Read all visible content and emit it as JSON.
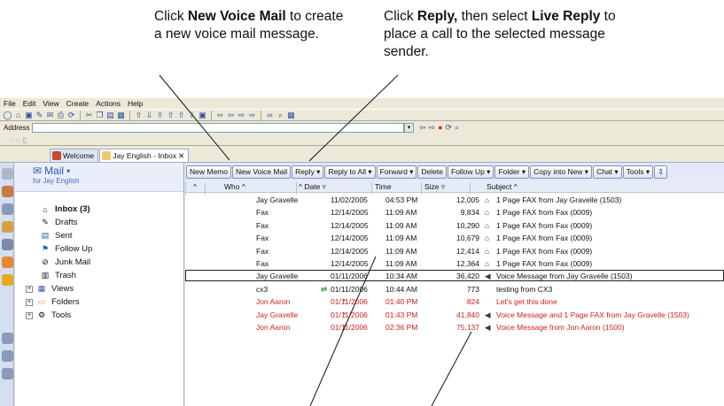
{
  "callouts": {
    "new_voice_mail": {
      "prefix": "Click ",
      "bold1": "New Voice Mail",
      "rest": " to create a new voice mail message."
    },
    "reply": {
      "prefix": "Click ",
      "bold1": "Reply,",
      "middle": " then select ",
      "bold2": "Live Reply",
      "rest": " to place a call to the selected message sender."
    }
  },
  "menu": [
    "File",
    "Edit",
    "View",
    "Create",
    "Actions",
    "Help"
  ],
  "address_label": "Address",
  "tabs": [
    {
      "label": "Welcome",
      "icon": "home-icon"
    },
    {
      "label": "Jay English - Inbox",
      "icon": "mail-icon"
    }
  ],
  "nav": {
    "title": "Mail",
    "subtitle": "for Jay English",
    "folders": [
      {
        "label": "Inbox (3)",
        "icon": "inbox-icon",
        "bold": true
      },
      {
        "label": "Drafts",
        "icon": "drafts-icon"
      },
      {
        "label": "Sent",
        "icon": "sent-icon"
      },
      {
        "label": "Follow Up",
        "icon": "follow-up-icon"
      },
      {
        "label": "Junk Mail",
        "icon": "junk-mail-icon"
      },
      {
        "label": "Trash",
        "icon": "trash-icon"
      },
      {
        "label": "Views",
        "icon": "views-icon"
      },
      {
        "label": "Folders",
        "icon": "folders-icon"
      },
      {
        "label": "Tools",
        "icon": "tools-icon"
      }
    ]
  },
  "action_buttons": [
    "New Memo",
    "New Voice Mail",
    "Reply ▾",
    "Reply to All ▾",
    "Forward ▾",
    "Delete",
    "Follow Up ▾",
    "Folder ▾",
    "Copy into New ▾",
    "Chat ▾",
    "Tools ▾"
  ],
  "columns": {
    "who": "Who ^",
    "date": "^ Date ▿",
    "time": "Time",
    "size": "Size ▿",
    "subject": "Subject ^"
  },
  "messages": [
    {
      "who": "Jay Gravelle",
      "date": "11/02/2005",
      "time": "04:53 PM",
      "size": "12,005",
      "subject": "1 Page FAX from Jay Gravelle (1503)",
      "urgent": false,
      "icon": "fax-icon"
    },
    {
      "who": "Fax",
      "date": "12/14/2005",
      "time": "11:09 AM",
      "size": "9,834",
      "subject": "1 Page FAX from Fax (0009)",
      "urgent": false,
      "icon": "fax-icon"
    },
    {
      "who": "Fax",
      "date": "12/14/2005",
      "time": "11:09 AM",
      "size": "10,290",
      "subject": "1 Page FAX from Fax (0009)",
      "urgent": false,
      "icon": "fax-icon"
    },
    {
      "who": "Fax",
      "date": "12/14/2005",
      "time": "11:09 AM",
      "size": "10,679",
      "subject": "1 Page FAX from Fax (0009)",
      "urgent": false,
      "icon": "fax-icon"
    },
    {
      "who": "Fax",
      "date": "12/14/2005",
      "time": "11:09 AM",
      "size": "12,414",
      "subject": "1 Page FAX from Fax (0009)",
      "urgent": false,
      "icon": "fax-icon"
    },
    {
      "who": "Fax",
      "date": "12/14/2005",
      "time": "11:09 AM",
      "size": "12,364",
      "subject": "1 Page FAX from Fax (0009)",
      "urgent": false,
      "icon": "fax-icon"
    },
    {
      "who": "Jay Gravelle",
      "date": "01/11/2006",
      "time": "10:34 AM",
      "size": "36,420",
      "subject": "Voice Message from Jay Gravelle (1503)",
      "urgent": false,
      "icon": "voice-icon",
      "selected": true
    },
    {
      "who": "cx3",
      "date": "01/11/2006",
      "time": "10:44 AM",
      "size": "773",
      "subject": "testing from CX3",
      "urgent": false,
      "icon": "",
      "date_icon": true
    },
    {
      "who": "Jon Aaron",
      "date": "01/11/2006",
      "time": "01:40 PM",
      "size": "824",
      "subject": "Let's get this done",
      "urgent": true,
      "icon": ""
    },
    {
      "who": "Jay Gravelle",
      "date": "01/11/2006",
      "time": "01:43 PM",
      "size": "41,840",
      "subject": "Voice Message and 1 Page FAX from Jay Gravelle (1503)",
      "urgent": true,
      "icon": "voice-icon"
    },
    {
      "who": "Jon Aaron",
      "date": "01/11/2006",
      "time": "02:36 PM",
      "size": "75,137",
      "subject": "Voice Message from Jon Aaron (1500)",
      "urgent": true,
      "icon": "voice-icon"
    }
  ],
  "colors": {
    "accent": "#2a58b4",
    "urgent": "#d42020",
    "chrome": "#ece9d8"
  }
}
